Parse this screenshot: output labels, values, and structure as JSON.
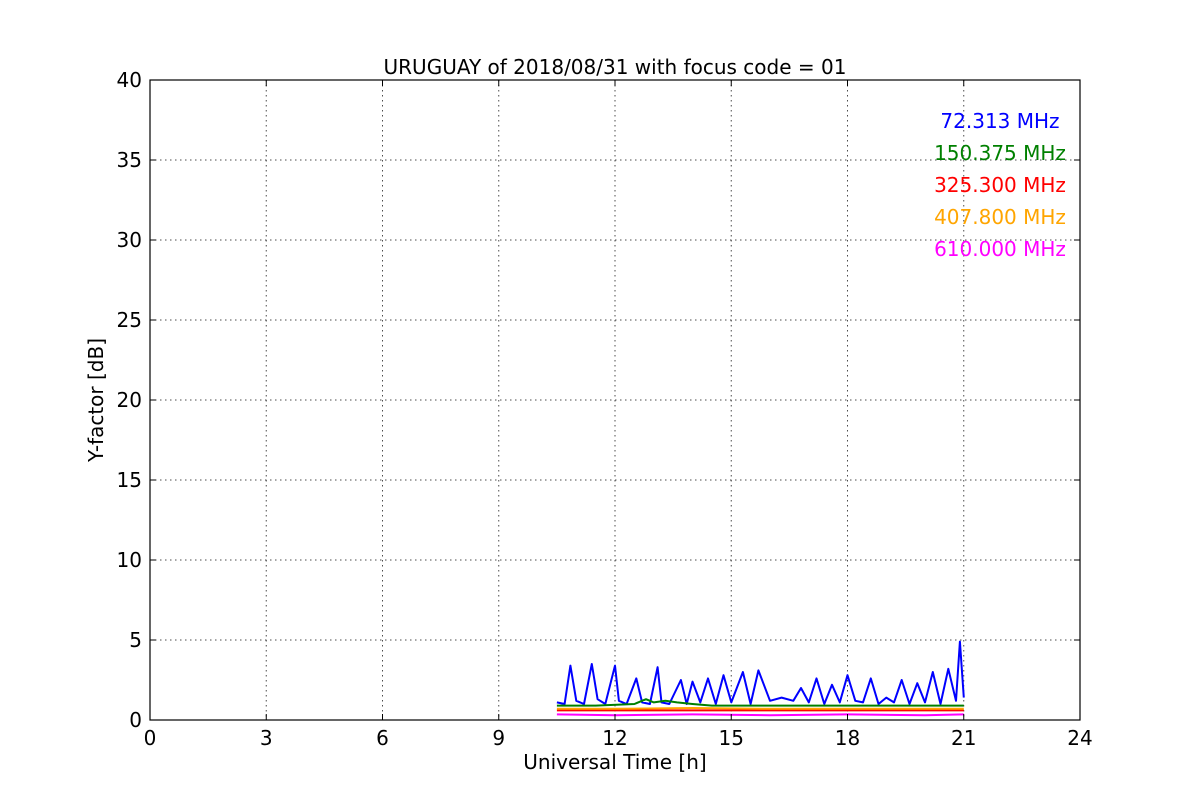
{
  "chart_data": {
    "type": "line",
    "title": "URUGUAY of 2018/08/31 with focus code = 01",
    "xlabel": "Universal Time [h]",
    "ylabel": "Y-factor [dB]",
    "xlim": [
      0,
      24
    ],
    "ylim": [
      0,
      40
    ],
    "xticks": [
      "0",
      "3",
      "6",
      "9",
      "12",
      "15",
      "18",
      "21",
      "24"
    ],
    "yticks": [
      "0",
      "5",
      "10",
      "15",
      "20",
      "25",
      "30",
      "35",
      "40"
    ],
    "grid": true,
    "legend_position": "top-right",
    "series": [
      {
        "name": "72.313 MHz",
        "color": "#0000ff",
        "x": [
          10.5,
          10.7,
          10.85,
          11.0,
          11.2,
          11.4,
          11.55,
          11.75,
          12.0,
          12.1,
          12.3,
          12.55,
          12.7,
          12.9,
          13.1,
          13.2,
          13.4,
          13.7,
          13.85,
          14.0,
          14.2,
          14.4,
          14.6,
          14.8,
          15.0,
          15.3,
          15.5,
          15.7,
          16.0,
          16.3,
          16.6,
          16.8,
          17.0,
          17.2,
          17.4,
          17.6,
          17.8,
          18.0,
          18.2,
          18.4,
          18.6,
          18.8,
          19.0,
          19.2,
          19.4,
          19.6,
          19.8,
          20.0,
          20.2,
          20.4,
          20.6,
          20.8,
          20.9,
          21.0
        ],
        "y": [
          1.1,
          1.0,
          3.4,
          1.2,
          1.0,
          3.5,
          1.3,
          1.0,
          3.4,
          1.2,
          1.0,
          2.6,
          1.1,
          1.0,
          3.3,
          1.1,
          1.0,
          2.5,
          1.0,
          2.4,
          1.1,
          2.6,
          1.0,
          2.8,
          1.1,
          3.0,
          1.0,
          3.1,
          1.2,
          1.4,
          1.2,
          2.0,
          1.1,
          2.6,
          1.0,
          2.2,
          1.1,
          2.8,
          1.2,
          1.1,
          2.6,
          1.0,
          1.4,
          1.1,
          2.5,
          1.0,
          2.3,
          1.1,
          3.0,
          1.0,
          3.2,
          1.2,
          4.9,
          1.4
        ]
      },
      {
        "name": "150.375 MHz",
        "color": "#008000",
        "x": [
          10.5,
          11.5,
          12.5,
          12.8,
          13.0,
          13.3,
          13.6,
          14.0,
          14.5,
          15.5,
          16.5,
          17.5,
          18.5,
          19.5,
          20.5,
          21.0
        ],
        "y": [
          0.9,
          0.9,
          1.0,
          1.3,
          1.1,
          1.2,
          1.1,
          1.0,
          0.9,
          0.9,
          0.9,
          0.9,
          0.9,
          0.9,
          0.9,
          0.9
        ]
      },
      {
        "name": "325.300 MHz",
        "color": "#ff0000",
        "x": [
          10.5,
          12.0,
          14.0,
          16.0,
          18.0,
          20.0,
          21.0
        ],
        "y": [
          0.6,
          0.6,
          0.6,
          0.6,
          0.6,
          0.6,
          0.6
        ]
      },
      {
        "name": "407.800 MHz",
        "color": "#ffa500",
        "x": [
          10.5,
          12.0,
          14.0,
          16.0,
          18.0,
          20.0,
          21.0
        ],
        "y": [
          0.7,
          0.7,
          0.75,
          0.7,
          0.7,
          0.7,
          0.7
        ]
      },
      {
        "name": "610.000 MHz",
        "color": "#ff00ff",
        "x": [
          10.5,
          12.0,
          14.0,
          16.0,
          18.0,
          20.0,
          21.0
        ],
        "y": [
          0.35,
          0.3,
          0.35,
          0.3,
          0.35,
          0.3,
          0.35
        ]
      }
    ]
  }
}
